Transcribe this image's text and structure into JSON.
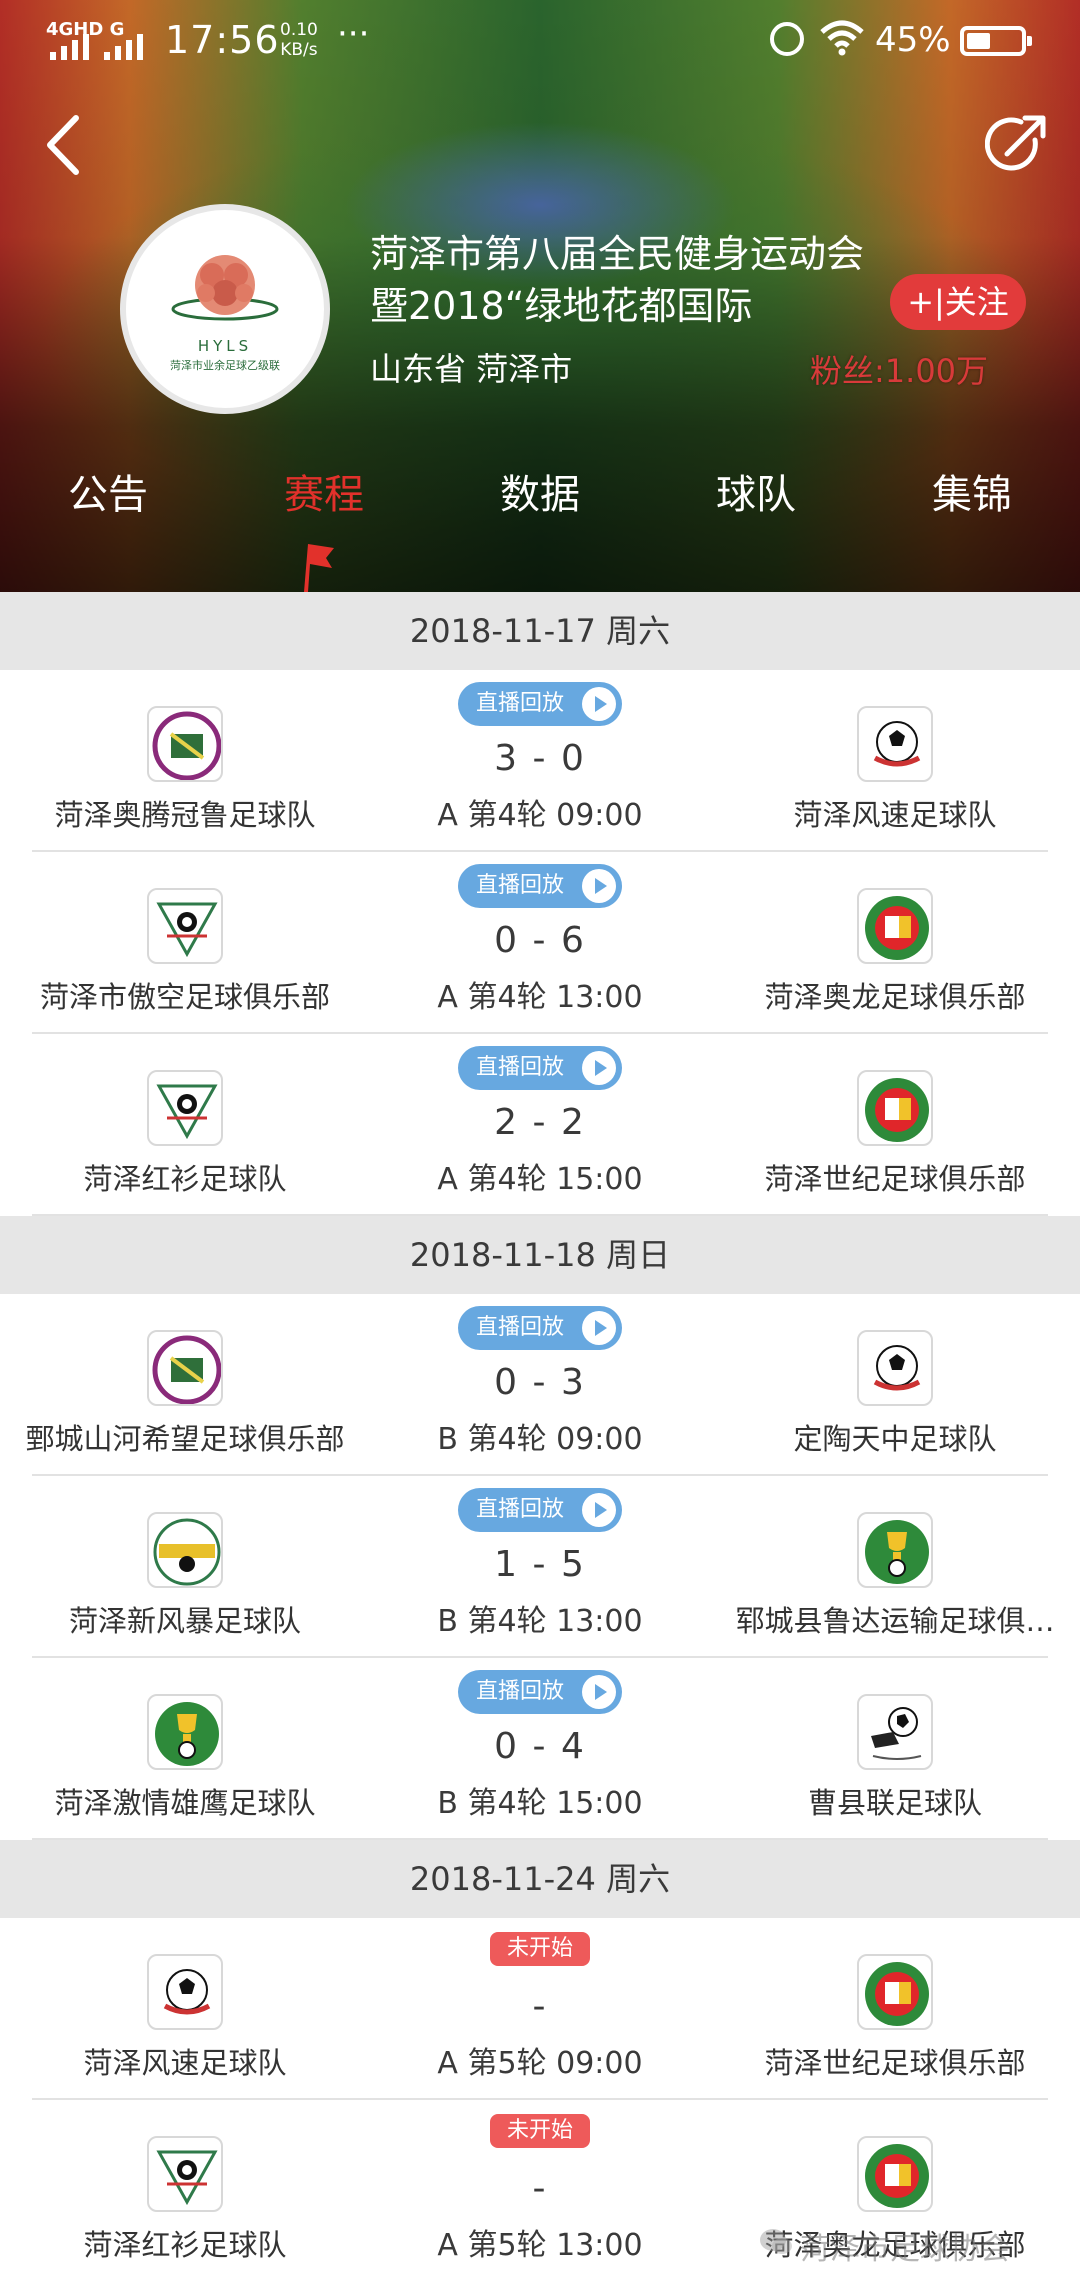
{
  "status_bar": {
    "network": "4GHD G",
    "time": "17:56",
    "speed_value": "0.10",
    "speed_unit": "KB/s",
    "more": "···",
    "battery": "45%",
    "battery_level": 0.45
  },
  "header": {
    "back_icon": "chevron-left-icon",
    "share_icon": "share-icon",
    "league_logo": {
      "abbr": "HYLS",
      "subtitle": "菏泽市业余足球乙级联"
    },
    "title": "菏泽市第八届全民健身运动会暨2018“绿地花都国际",
    "location": "山东省 菏泽市",
    "follow_label": "+|关注",
    "fans": "粉丝:1.00万"
  },
  "tabs": [
    {
      "label": "公告",
      "active": false
    },
    {
      "label": "赛程",
      "active": true
    },
    {
      "label": "数据",
      "active": false
    },
    {
      "label": "球队",
      "active": false
    },
    {
      "label": "集锦",
      "active": false
    }
  ],
  "schedule": [
    {
      "date": "2018-11-17 周六",
      "matches": [
        {
          "badge": "直播回放",
          "score": "3 - 0",
          "round": "A 第4轮 09:00",
          "home": "菏泽奥腾冠鲁足球队",
          "away": "菏泽风速足球队",
          "home_logo": "purple-crest",
          "away_logo": "soccer-ball"
        },
        {
          "badge": "直播回放",
          "score": "0 - 6",
          "round": "A 第4轮 13:00",
          "home": "菏泽市傲空足球俱乐部",
          "away": "菏泽奥龙足球俱乐部",
          "home_logo": "triangle-crest",
          "away_logo": "green-crest"
        },
        {
          "badge": "直播回放",
          "score": "2 - 2",
          "round": "A 第4轮 15:00",
          "home": "菏泽红衫足球队",
          "away": "菏泽世纪足球俱乐部",
          "home_logo": "triangle-crest",
          "away_logo": "green-crest"
        }
      ]
    },
    {
      "date": "2018-11-18 周日",
      "matches": [
        {
          "badge": "直播回放",
          "score": "0 - 3",
          "round": "B 第4轮 09:00",
          "home": "鄄城山河希望足球俱乐部",
          "away": "定陶天中足球队",
          "home_logo": "purple-crest",
          "away_logo": "soccer-ball"
        },
        {
          "badge": "直播回放",
          "score": "1 - 5",
          "round": "B 第4轮 13:00",
          "home": "菏泽新风暴足球队",
          "away": "郓城县鲁达运输足球俱…",
          "home_logo": "yellow-crest",
          "away_logo": "green-trophy-crest"
        },
        {
          "badge": "直播回放",
          "score": "0 - 4",
          "round": "B 第4轮 15:00",
          "home": "菏泽激情雄鹰足球队",
          "away": "曹县联足球队",
          "home_logo": "green-trophy-crest",
          "away_logo": "boot-ball"
        }
      ]
    },
    {
      "date": "2018-11-24 周六",
      "matches": [
        {
          "badge": "未开始",
          "score": "-",
          "round": "A 第5轮 09:00",
          "home": "菏泽风速足球队",
          "away": "菏泽世纪足球俱乐部",
          "home_logo": "soccer-ball",
          "away_logo": "green-crest"
        },
        {
          "badge": "未开始",
          "score": "-",
          "round": "A 第5轮 13:00",
          "home": "菏泽红衫足球队",
          "away": "菏泽奥龙足球俱乐部",
          "home_logo": "triangle-crest",
          "away_logo": "green-crest"
        }
      ]
    }
  ],
  "watermark": "菏泽市足球协会",
  "colors": {
    "accent_red": "#e2312b",
    "replay_blue": "#67a8e0",
    "pending_red": "#ee5a5a",
    "date_bar": "#e6e6e6"
  }
}
